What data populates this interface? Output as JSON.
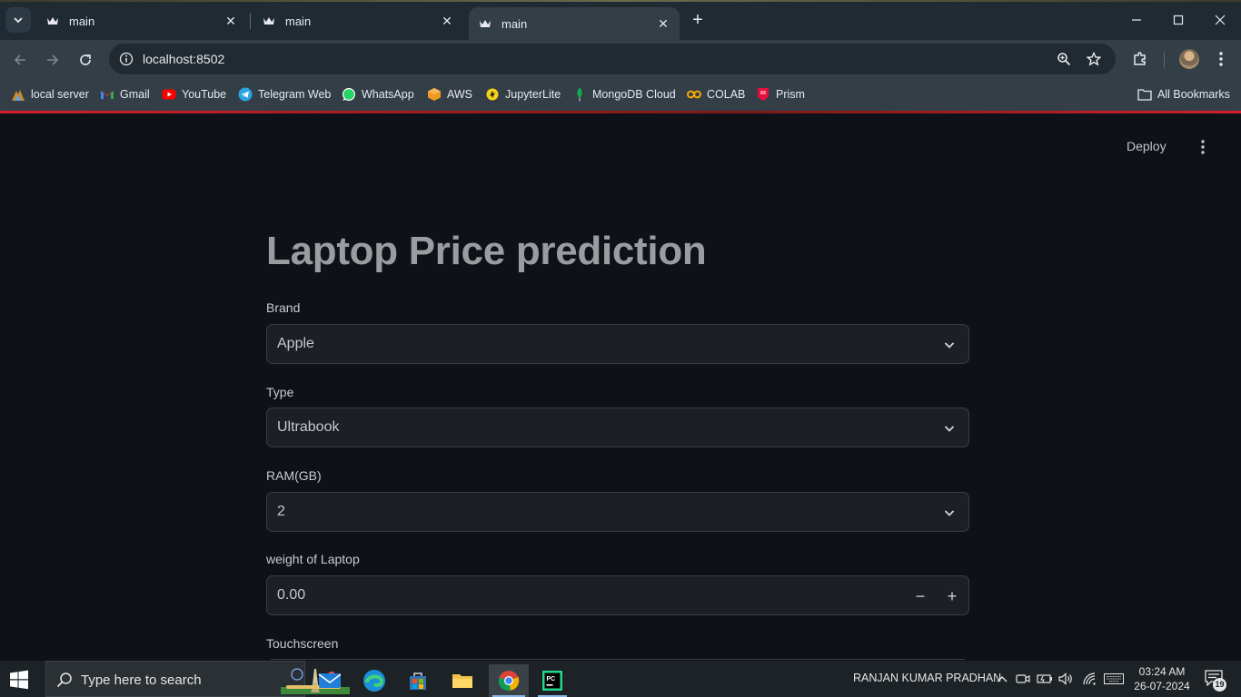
{
  "browser": {
    "tabs": [
      {
        "title": "main",
        "active": false
      },
      {
        "title": "main",
        "active": false
      },
      {
        "title": "main",
        "active": true
      }
    ],
    "url": "localhost:8502",
    "bookmarks": [
      {
        "label": "local server",
        "icon": "local-server-icon"
      },
      {
        "label": "Gmail",
        "icon": "gmail-icon"
      },
      {
        "label": "YouTube",
        "icon": "youtube-icon"
      },
      {
        "label": "Telegram Web",
        "icon": "telegram-icon"
      },
      {
        "label": "WhatsApp",
        "icon": "whatsapp-icon"
      },
      {
        "label": "AWS",
        "icon": "aws-icon"
      },
      {
        "label": "JupyterLite",
        "icon": "jupyterlite-icon"
      },
      {
        "label": "MongoDB Cloud",
        "icon": "mongodb-icon"
      },
      {
        "label": "COLAB",
        "icon": "colab-icon"
      },
      {
        "label": "Prism",
        "icon": "prism-icon"
      }
    ],
    "all_bookmarks": "All Bookmarks"
  },
  "app": {
    "deploy_label": "Deploy",
    "title": "Laptop Price prediction",
    "fields": {
      "brand": {
        "label": "Brand",
        "value": "Apple"
      },
      "type": {
        "label": "Type",
        "value": "Ultrabook"
      },
      "ram": {
        "label": "RAM(GB)",
        "value": "2"
      },
      "weight": {
        "label": "weight of Laptop",
        "value": "0.00",
        "minus": "−",
        "plus": "+"
      },
      "touchscreen": {
        "label": "Touchscreen"
      }
    }
  },
  "taskbar": {
    "search_placeholder": "Type here to search",
    "user_name": "RANJAN KUMAR PRADHAN",
    "time": "03:24 AM",
    "date": "26-07-2024",
    "notifications": "19"
  },
  "colors": {
    "background": "#0e1117",
    "title": "#9a9ca0",
    "input_bg": "#1e1f26",
    "accent_red": "#d4202a"
  }
}
